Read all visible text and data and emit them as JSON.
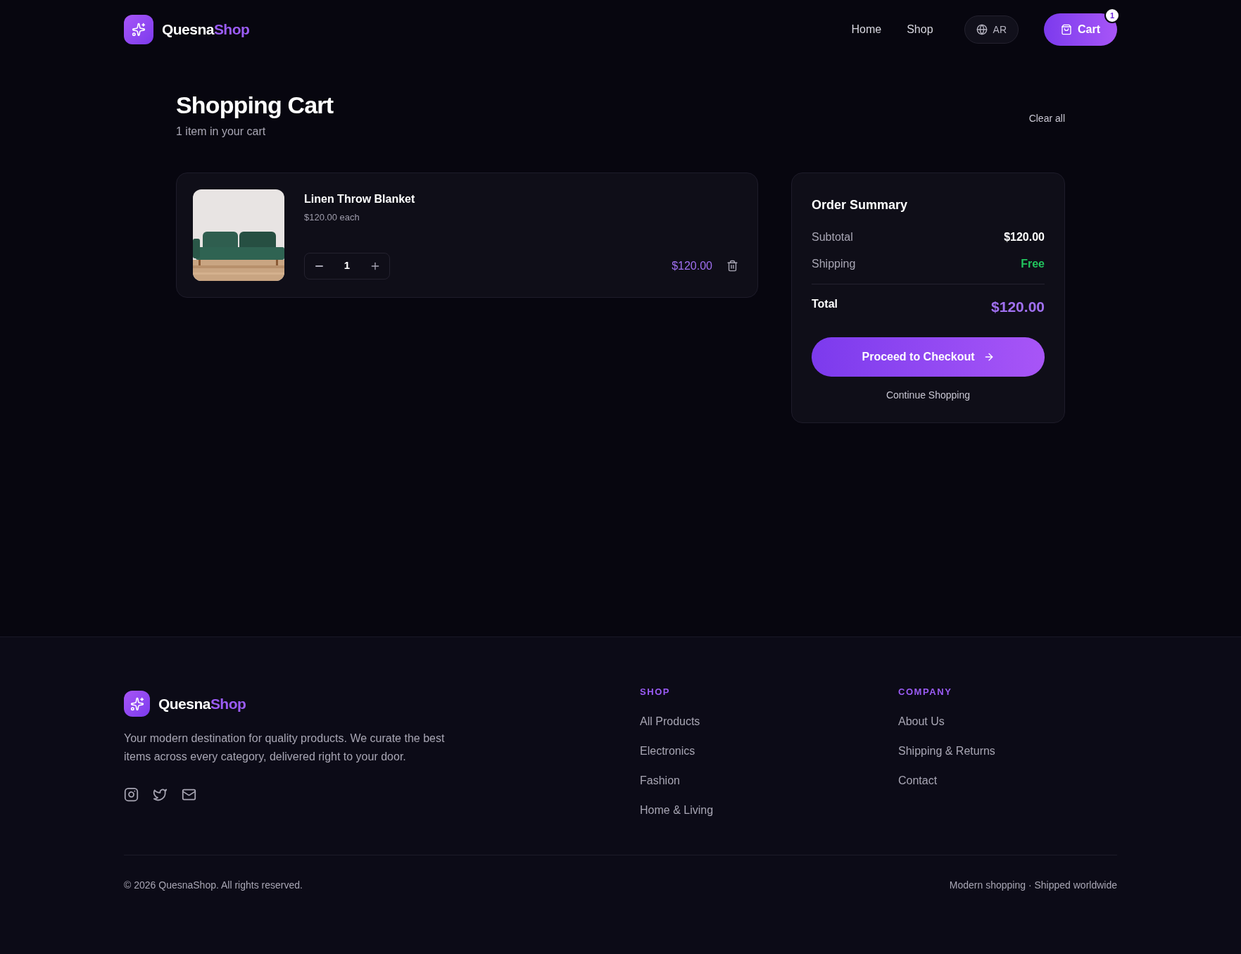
{
  "header": {
    "brand": {
      "first": "Quesna",
      "second": "Shop"
    },
    "nav": [
      "Home",
      "Shop"
    ],
    "language": "AR",
    "cart": {
      "label": "Cart",
      "count": "1"
    }
  },
  "page": {
    "title": "Shopping Cart",
    "subtitle": "1 item in your cart",
    "clear_all": "Clear all"
  },
  "items": [
    {
      "name": "Linen Throw Blanket",
      "unit_price": "$120.00 each",
      "quantity": "1",
      "line_total": "$120.00"
    }
  ],
  "summary": {
    "title": "Order Summary",
    "rows": [
      {
        "label": "Subtotal",
        "value": "$120.00",
        "kind": "amount"
      },
      {
        "label": "Shipping",
        "value": "Free",
        "kind": "free"
      }
    ],
    "total_label": "Total",
    "total_value": "$120.00",
    "checkout": "Proceed to Checkout",
    "continue": "Continue Shopping"
  },
  "footer": {
    "brand": {
      "first": "Quesna",
      "second": "Shop"
    },
    "description": "Your modern destination for quality products. We curate the best items across every category, delivered right to your door.",
    "columns": [
      {
        "heading": "SHOP",
        "links": [
          "All Products",
          "Electronics",
          "Fashion",
          "Home & Living"
        ]
      },
      {
        "heading": "COMPANY",
        "links": [
          "About Us",
          "Shipping & Returns",
          "Contact"
        ]
      }
    ],
    "copyright": "© 2026 QuesnaShop. All rights reserved.",
    "tagline": "Modern shopping · Shipped worldwide"
  }
}
